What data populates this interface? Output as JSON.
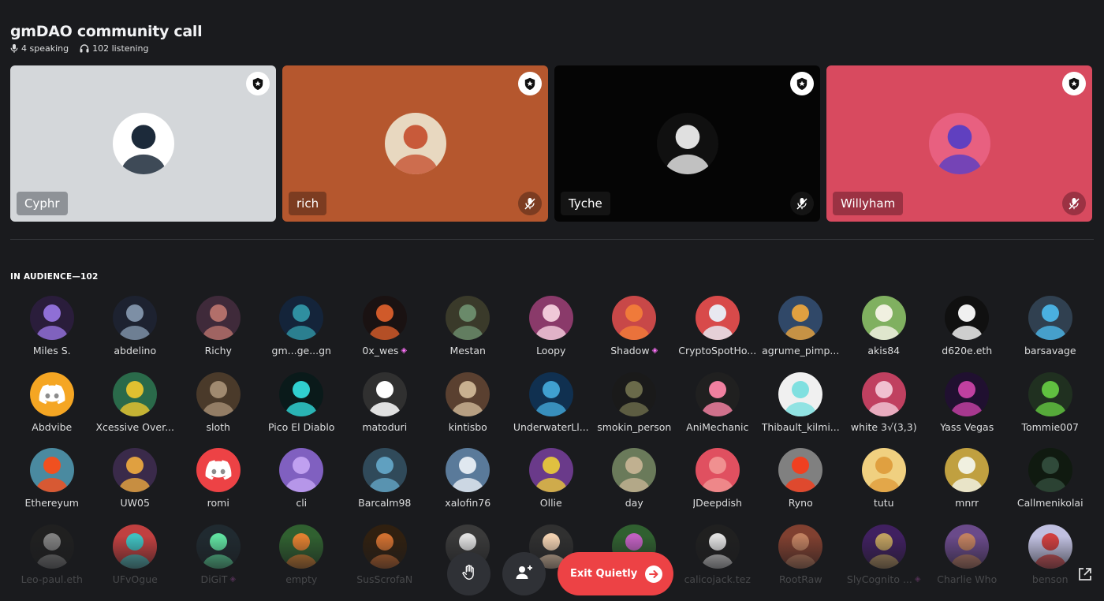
{
  "header": {
    "title": "gmDAO community call",
    "speaking": "4 speaking",
    "listening": "102 listening"
  },
  "speakers": [
    {
      "name": "Cyphr",
      "bg": "#d4d7da",
      "chip": "#8e9297",
      "muted": false
    },
    {
      "name": "rich",
      "bg": "#b5572e",
      "chip": "#7c3c21",
      "muted": true
    },
    {
      "name": "Tyche",
      "bg": "#050505",
      "chip": "#141414",
      "muted": true
    },
    {
      "name": "Willyham",
      "bg": "#d84a5f",
      "chip": "#9b3243",
      "muted": true
    }
  ],
  "audience": {
    "title": "IN AUDIENCE—102",
    "members": [
      {
        "name": "Miles S.",
        "c1": "#8f6fd6",
        "c2": "#2a1d3b"
      },
      {
        "name": "abdelino",
        "c1": "#7d8fa5",
        "c2": "#1d2230"
      },
      {
        "name": "Richy",
        "c1": "#b26f6a",
        "c2": "#3f2a3a"
      },
      {
        "name": "gm...ge...gn",
        "c1": "#2f8fa0",
        "c2": "#14243a"
      },
      {
        "name": "0x_wes",
        "c1": "#d05a2a",
        "c2": "#1a1212",
        "boost": true
      },
      {
        "name": "Mestan",
        "c1": "#6a8a6a",
        "c2": "#3a3a2a"
      },
      {
        "name": "Loopy",
        "c1": "#f0c8d8",
        "c2": "#8a3a6a"
      },
      {
        "name": "Shadow",
        "c1": "#f07a3a",
        "c2": "#c84848",
        "boost": true
      },
      {
        "name": "CryptoSpotHo...",
        "c1": "#e8e8f0",
        "c2": "#d84a4a"
      },
      {
        "name": "agrume_pimp...",
        "c1": "#e0a040",
        "c2": "#304868"
      },
      {
        "name": "akis84",
        "c1": "#f0f0e0",
        "c2": "#80b060"
      },
      {
        "name": "d620e.eth",
        "c1": "#f0f0f0",
        "c2": "#101010"
      },
      {
        "name": "barsavage",
        "c1": "#4ab0e0",
        "c2": "#304050"
      },
      {
        "name": "Abdvibe",
        "c1": "#f5a623",
        "c2": "#f5a623",
        "discord": true
      },
      {
        "name": "Xcessive Over...",
        "c1": "#e0c030",
        "c2": "#2a6a4a"
      },
      {
        "name": "sloth",
        "c1": "#a08a70",
        "c2": "#4a3a2a"
      },
      {
        "name": "Pico El Diablo",
        "c1": "#30d0d0",
        "c2": "#0a1a1a"
      },
      {
        "name": "matoduri",
        "c1": "#ffffff",
        "c2": "#303030"
      },
      {
        "name": "kintisbo",
        "c1": "#c8b090",
        "c2": "#5a4030"
      },
      {
        "name": "UnderwaterLl...",
        "c1": "#40a0d0",
        "c2": "#103050"
      },
      {
        "name": "smokin_person",
        "c1": "#6a6a4a",
        "c2": "#1a1a1a"
      },
      {
        "name": "AniMechanic",
        "c1": "#f080a0",
        "c2": "#202020"
      },
      {
        "name": "Thibault_kilmi...",
        "c1": "#80e0e0",
        "c2": "#f0f0f0"
      },
      {
        "name": "white 3√(3,3)",
        "c1": "#f0c0d0",
        "c2": "#c04060"
      },
      {
        "name": "Yass Vegas",
        "c1": "#c040a0",
        "c2": "#201030"
      },
      {
        "name": "Tommie007",
        "c1": "#60c040",
        "c2": "#203020"
      },
      {
        "name": "Ethereyum",
        "c1": "#f05020",
        "c2": "#4a8aa0"
      },
      {
        "name": "UW05",
        "c1": "#e0a040",
        "c2": "#3a2a4a"
      },
      {
        "name": "romi",
        "c1": "#ed4245",
        "c2": "#ed4245",
        "discord": true
      },
      {
        "name": "cli",
        "c1": "#c0a0f0",
        "c2": "#8060c0"
      },
      {
        "name": "Barcalm98",
        "c1": "#60a0c0",
        "c2": "#304a5a"
      },
      {
        "name": "xalofin76",
        "c1": "#e0e8f0",
        "c2": "#5a7a9a"
      },
      {
        "name": "Ollie",
        "c1": "#e0c040",
        "c2": "#6a3a8a"
      },
      {
        "name": "day",
        "c1": "#c0b090",
        "c2": "#6a7a5a"
      },
      {
        "name": "JDeepdish",
        "c1": "#f09090",
        "c2": "#e05060"
      },
      {
        "name": "Ryno",
        "c1": "#f04020",
        "c2": "#808080"
      },
      {
        "name": "tutu",
        "c1": "#e0a040",
        "c2": "#f0d080"
      },
      {
        "name": "mnrr",
        "c1": "#f0f0e0",
        "c2": "#c0a040"
      },
      {
        "name": "Callmenikolai",
        "c1": "#304a3a",
        "c2": "#101a10"
      },
      {
        "name": "Leo-paul.eth",
        "c1": "#808080",
        "c2": "#202020"
      },
      {
        "name": "UFvOgue",
        "c1": "#40c0c0",
        "c2": "#c04040"
      },
      {
        "name": "DiGiT",
        "c1": "#60e0a0",
        "c2": "#202a30",
        "boost": true
      },
      {
        "name": "empty",
        "c1": "#e08030",
        "c2": "#306030"
      },
      {
        "name": "SusScrofaN",
        "c1": "#d07030",
        "c2": "#302010"
      },
      {
        "name": "",
        "c1": "#e0e0e0",
        "c2": "#3a3a3a"
      },
      {
        "name": "",
        "c1": "#f0d0b0",
        "c2": "#303030"
      },
      {
        "name": "",
        "c1": "#c060c0",
        "c2": "#306030"
      },
      {
        "name": "calicojack.tez",
        "c1": "#e0e0e0",
        "c2": "#202020"
      },
      {
        "name": "RootRaw",
        "c1": "#c08060",
        "c2": "#804030"
      },
      {
        "name": "SlyCognito ...",
        "c1": "#c0a060",
        "c2": "#402060",
        "boost": true
      },
      {
        "name": "Charlie Who",
        "c1": "#c08060",
        "c2": "#6a4a8a"
      },
      {
        "name": "benson",
        "c1": "#d04040",
        "c2": "#c0c0e0"
      }
    ]
  },
  "controls": {
    "exit_label": "Exit Quietly"
  }
}
